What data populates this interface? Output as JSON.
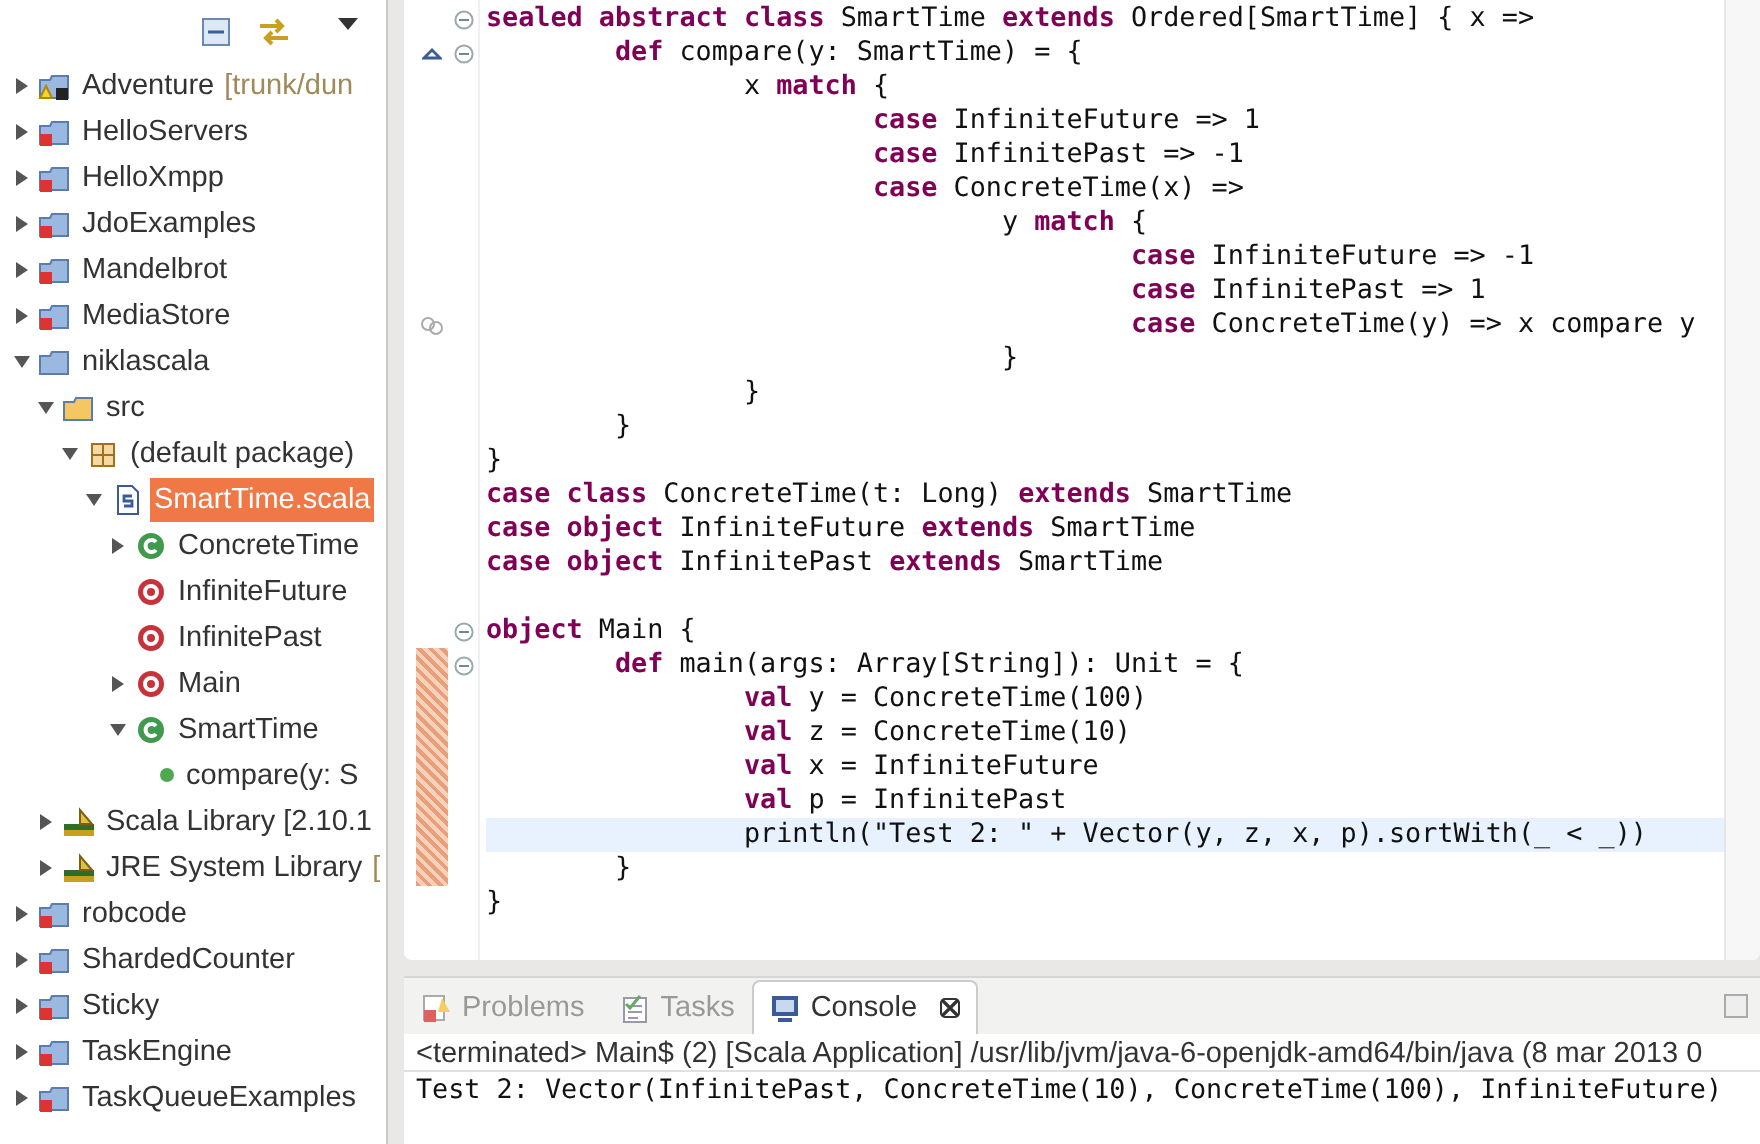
{
  "explorer": {
    "tree": [
      {
        "label": "Adventure",
        "decoration": "[trunk/dun",
        "kind": "project-warning",
        "expanded": false,
        "selected": false
      },
      {
        "label": "HelloServers",
        "kind": "project-error",
        "expanded": false,
        "selected": false
      },
      {
        "label": "HelloXmpp",
        "kind": "project-error",
        "expanded": false,
        "selected": false
      },
      {
        "label": "JdoExamples",
        "kind": "project-error",
        "expanded": false,
        "selected": false
      },
      {
        "label": "Mandelbrot",
        "kind": "project-error",
        "expanded": false,
        "selected": false
      },
      {
        "label": "MediaStore",
        "kind": "project-error",
        "expanded": false,
        "selected": false
      },
      {
        "label": "niklascala",
        "kind": "project",
        "expanded": true,
        "selected": false,
        "children": [
          {
            "label": "src",
            "kind": "folder",
            "expanded": true,
            "selected": false,
            "children": [
              {
                "label": "(default package)",
                "kind": "package",
                "expanded": true,
                "selected": false,
                "children": [
                  {
                    "label": "SmartTime.scala",
                    "kind": "file",
                    "expanded": true,
                    "selected": true,
                    "children": [
                      {
                        "label": "ConcreteTime",
                        "kind": "class",
                        "expanded": false,
                        "selected": false
                      },
                      {
                        "label": "InfiniteFuture",
                        "kind": "object",
                        "selected": false
                      },
                      {
                        "label": "InfinitePast",
                        "kind": "object",
                        "selected": false
                      },
                      {
                        "label": "Main",
                        "kind": "object",
                        "expanded": false,
                        "selected": false
                      },
                      {
                        "label": "SmartTime",
                        "kind": "class",
                        "expanded": true,
                        "selected": false,
                        "children": [
                          {
                            "label": "compare(y: S",
                            "kind": "method",
                            "selected": false
                          }
                        ]
                      }
                    ]
                  }
                ]
              }
            ]
          },
          {
            "label": "Scala Library [2.10.1",
            "kind": "library",
            "expanded": false,
            "selected": false
          },
          {
            "label": "JRE System Library",
            "decoration": "[",
            "kind": "library",
            "expanded": false,
            "selected": false
          }
        ]
      },
      {
        "label": "robcode",
        "kind": "project-error",
        "expanded": false,
        "selected": false
      },
      {
        "label": "ShardedCounter",
        "kind": "project-error",
        "expanded": false,
        "selected": false
      },
      {
        "label": "Sticky",
        "kind": "project-error",
        "expanded": false,
        "selected": false
      },
      {
        "label": "TaskEngine",
        "kind": "project-error",
        "expanded": false,
        "selected": false
      },
      {
        "label": "TaskQueueExamples",
        "kind": "project-error",
        "expanded": false,
        "selected": false
      }
    ]
  },
  "editor": {
    "lines": [
      {
        "kind": "code",
        "fold": true,
        "changed": false,
        "current": false,
        "text": "**sealed abstract class** SmartTime **extends** Ordered[SmartTime] { x =>"
      },
      {
        "kind": "override",
        "fold": true,
        "changed": false,
        "current": false,
        "text": "\t**def** compare(y: SmartTime) = {"
      },
      {
        "kind": "code",
        "fold": false,
        "changed": false,
        "current": false,
        "text": "\t\tx **match** {"
      },
      {
        "kind": "code",
        "fold": false,
        "changed": false,
        "current": false,
        "text": "\t\t\t**case** InfiniteFuture => 1"
      },
      {
        "kind": "code",
        "fold": false,
        "changed": false,
        "current": false,
        "text": "\t\t\t**case** InfinitePast => -1"
      },
      {
        "kind": "code",
        "fold": false,
        "changed": false,
        "current": false,
        "text": "\t\t\t**case** ConcreteTime(x) =>"
      },
      {
        "kind": "code",
        "fold": false,
        "changed": false,
        "current": false,
        "text": "\t\t\t\ty **match** {"
      },
      {
        "kind": "code",
        "fold": false,
        "changed": false,
        "current": false,
        "text": "\t\t\t\t\t**case** InfiniteFuture => -1"
      },
      {
        "kind": "code",
        "fold": false,
        "changed": false,
        "current": false,
        "text": "\t\t\t\t\t**case** InfinitePast => 1"
      },
      {
        "kind": "link",
        "fold": false,
        "changed": false,
        "current": false,
        "text": "\t\t\t\t\t**case** ConcreteTime(y) => x compare y"
      },
      {
        "kind": "code",
        "fold": false,
        "changed": false,
        "current": false,
        "text": "\t\t\t\t}"
      },
      {
        "kind": "code",
        "fold": false,
        "changed": false,
        "current": false,
        "text": "\t\t}"
      },
      {
        "kind": "code",
        "fold": false,
        "changed": false,
        "current": false,
        "text": "\t}"
      },
      {
        "kind": "code",
        "fold": false,
        "changed": false,
        "current": false,
        "text": "}"
      },
      {
        "kind": "code",
        "fold": false,
        "changed": false,
        "current": false,
        "text": "**case class** ConcreteTime(t: Long) **extends** SmartTime"
      },
      {
        "kind": "code",
        "fold": false,
        "changed": false,
        "current": false,
        "text": "**case object** InfiniteFuture **extends** SmartTime"
      },
      {
        "kind": "code",
        "fold": false,
        "changed": false,
        "current": false,
        "text": "**case object** InfinitePast **extends** SmartTime"
      },
      {
        "kind": "blank",
        "fold": false,
        "changed": false,
        "current": false
      },
      {
        "kind": "code",
        "fold": true,
        "changed": false,
        "current": false,
        "text": "**object** Main {"
      },
      {
        "kind": "code",
        "fold": true,
        "changed": true,
        "current": false,
        "text": "\t**def** main(args: Array[String]): Unit = {"
      },
      {
        "kind": "code",
        "fold": false,
        "changed": true,
        "current": false,
        "text": "\t\t**val** y = ConcreteTime(100)"
      },
      {
        "kind": "code",
        "fold": false,
        "changed": true,
        "current": false,
        "text": "\t\t**val** z = ConcreteTime(10)"
      },
      {
        "kind": "code",
        "fold": false,
        "changed": true,
        "current": false,
        "text": "\t\t**val** x = InfiniteFuture"
      },
      {
        "kind": "code",
        "fold": false,
        "changed": true,
        "current": false,
        "text": "\t\t**val** p = InfinitePast"
      },
      {
        "kind": "code",
        "fold": false,
        "changed": true,
        "current": true,
        "text": "\t\tprintln(\"Test 2: \" + Vector(y, z, x, p).sortWith(_ < _))"
      },
      {
        "kind": "code",
        "fold": false,
        "changed": true,
        "current": false,
        "text": "\t}"
      },
      {
        "kind": "code",
        "fold": false,
        "changed": false,
        "current": false,
        "text": "}"
      }
    ]
  },
  "panel": {
    "tabs": [
      {
        "label": "Problems",
        "kind": "problems",
        "selected": false
      },
      {
        "label": "Tasks",
        "kind": "tasks",
        "selected": false
      },
      {
        "label": "Console",
        "kind": "console",
        "selected": true
      }
    ],
    "console": {
      "header": "<terminated> Main$ (2) [Scala Application] /usr/lib/jvm/java-6-openjdk-amd64/bin/java (8 mar 2013 0",
      "output": "Test 2: Vector(InfinitePast, ConcreteTime(10), ConcreteTime(100), InfiniteFuture)"
    }
  }
}
